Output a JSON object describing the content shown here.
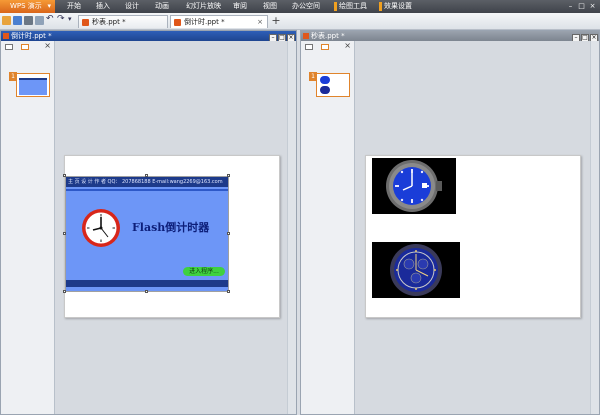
{
  "app": {
    "name": "WPS 演示"
  },
  "menu": {
    "items": [
      "开始",
      "插入",
      "设计",
      "动画",
      "幻灯片放映",
      "审阅",
      "视图",
      "办公空间",
      "绘图工具",
      "效果设置"
    ]
  },
  "tabs": [
    {
      "label": "秒表.ppt *",
      "active": false
    },
    {
      "label": "倒计时.ppt *",
      "active": true
    }
  ],
  "panes": {
    "left": {
      "title": "倒计时.ppt *",
      "slide_number": "1"
    },
    "right": {
      "title": "秒表.ppt *",
      "slide_number": "1"
    }
  },
  "slide_left": {
    "header_text": "主 页 设 计 作 者    QQ：   207868188 E-mail:wang2269@163.com",
    "title": "Flash倒计时器",
    "button": "进入程序..."
  },
  "colors": {
    "accent": "#e0842c",
    "slide_bg": "#6d96f7",
    "watch_face": "#1a3dd8"
  }
}
